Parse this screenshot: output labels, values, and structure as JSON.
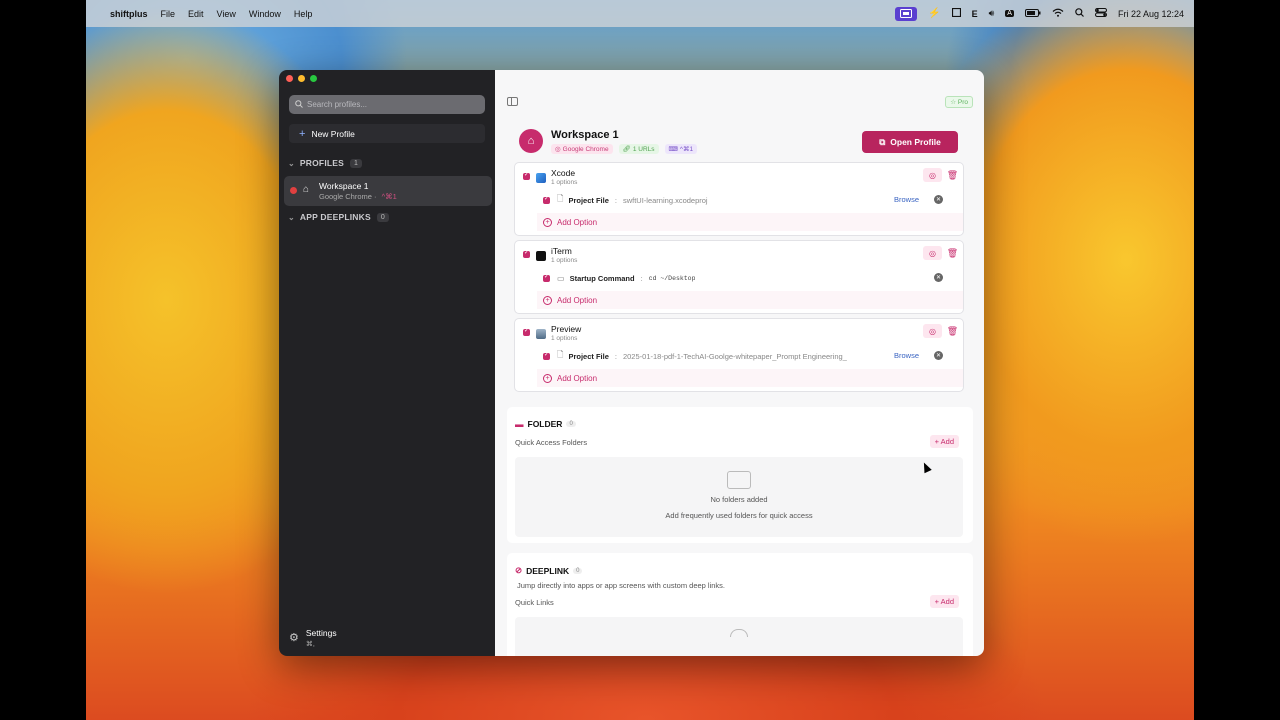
{
  "menubar": {
    "app_name": "shiftplus",
    "menus": [
      "File",
      "Edit",
      "View",
      "Window",
      "Help"
    ],
    "clock": "Fri 22 Aug  12:24",
    "status_icons": [
      "screen-icon",
      "bolt-icon",
      "square-icon",
      "E",
      "volume-icon",
      "A",
      "battery-icon",
      "wifi-icon",
      "search-icon",
      "control-center-icon"
    ]
  },
  "sidebar": {
    "search_placeholder": "Search profiles...",
    "new_profile_label": "New Profile",
    "profiles_section": "PROFILES",
    "profiles_count": "1",
    "deeplinks_section": "APP DEEPLINKS",
    "deeplinks_count": "0",
    "profile_items": [
      {
        "name": "Workspace 1",
        "browser": "Google Chrome",
        "shortcut": "^⌘1"
      }
    ],
    "settings_label": "Settings",
    "settings_shortcut": "⌘,"
  },
  "main": {
    "pro_badge": "Pro",
    "profile": {
      "name": "Workspace 1",
      "browser_chip": "Google Chrome",
      "urls_chip": "1 URLs",
      "shortcut_chip": "^⌘1",
      "open_button": "Open Profile"
    },
    "apps": [
      {
        "name": "Xcode",
        "options_count": "1 options",
        "option_label": "Project File",
        "option_value": "swftUI-learning.xcodeproj",
        "browse": "Browse",
        "add_option": "Add Option"
      },
      {
        "name": "iTerm",
        "options_count": "1 options",
        "option_label": "Startup Command",
        "option_value": "cd ~/Desktop",
        "add_option": "Add Option"
      },
      {
        "name": "Preview",
        "options_count": "1 options",
        "option_label": "Project File",
        "option_value": "2025-01-18-pdf-1-TechAI-Goolge-whitepaper_Prompt Engineering_",
        "browse": "Browse",
        "add_option": "Add Option"
      }
    ],
    "folder": {
      "title": "FOLDER",
      "count": "0",
      "subtitle": "Quick Access Folders",
      "add": "+ Add",
      "empty_title": "No folders added",
      "empty_sub": "Add frequently used folders for quick access"
    },
    "deeplink": {
      "title": "DEEPLINK",
      "count": "0",
      "description": "Jump directly into apps or app screens with custom deep links.",
      "subtitle": "Quick Links",
      "add": "+ Add"
    }
  },
  "colors": {
    "accent": "#c72b6c",
    "sidebar_bg": "#222225",
    "open_button": "#b8245e"
  }
}
